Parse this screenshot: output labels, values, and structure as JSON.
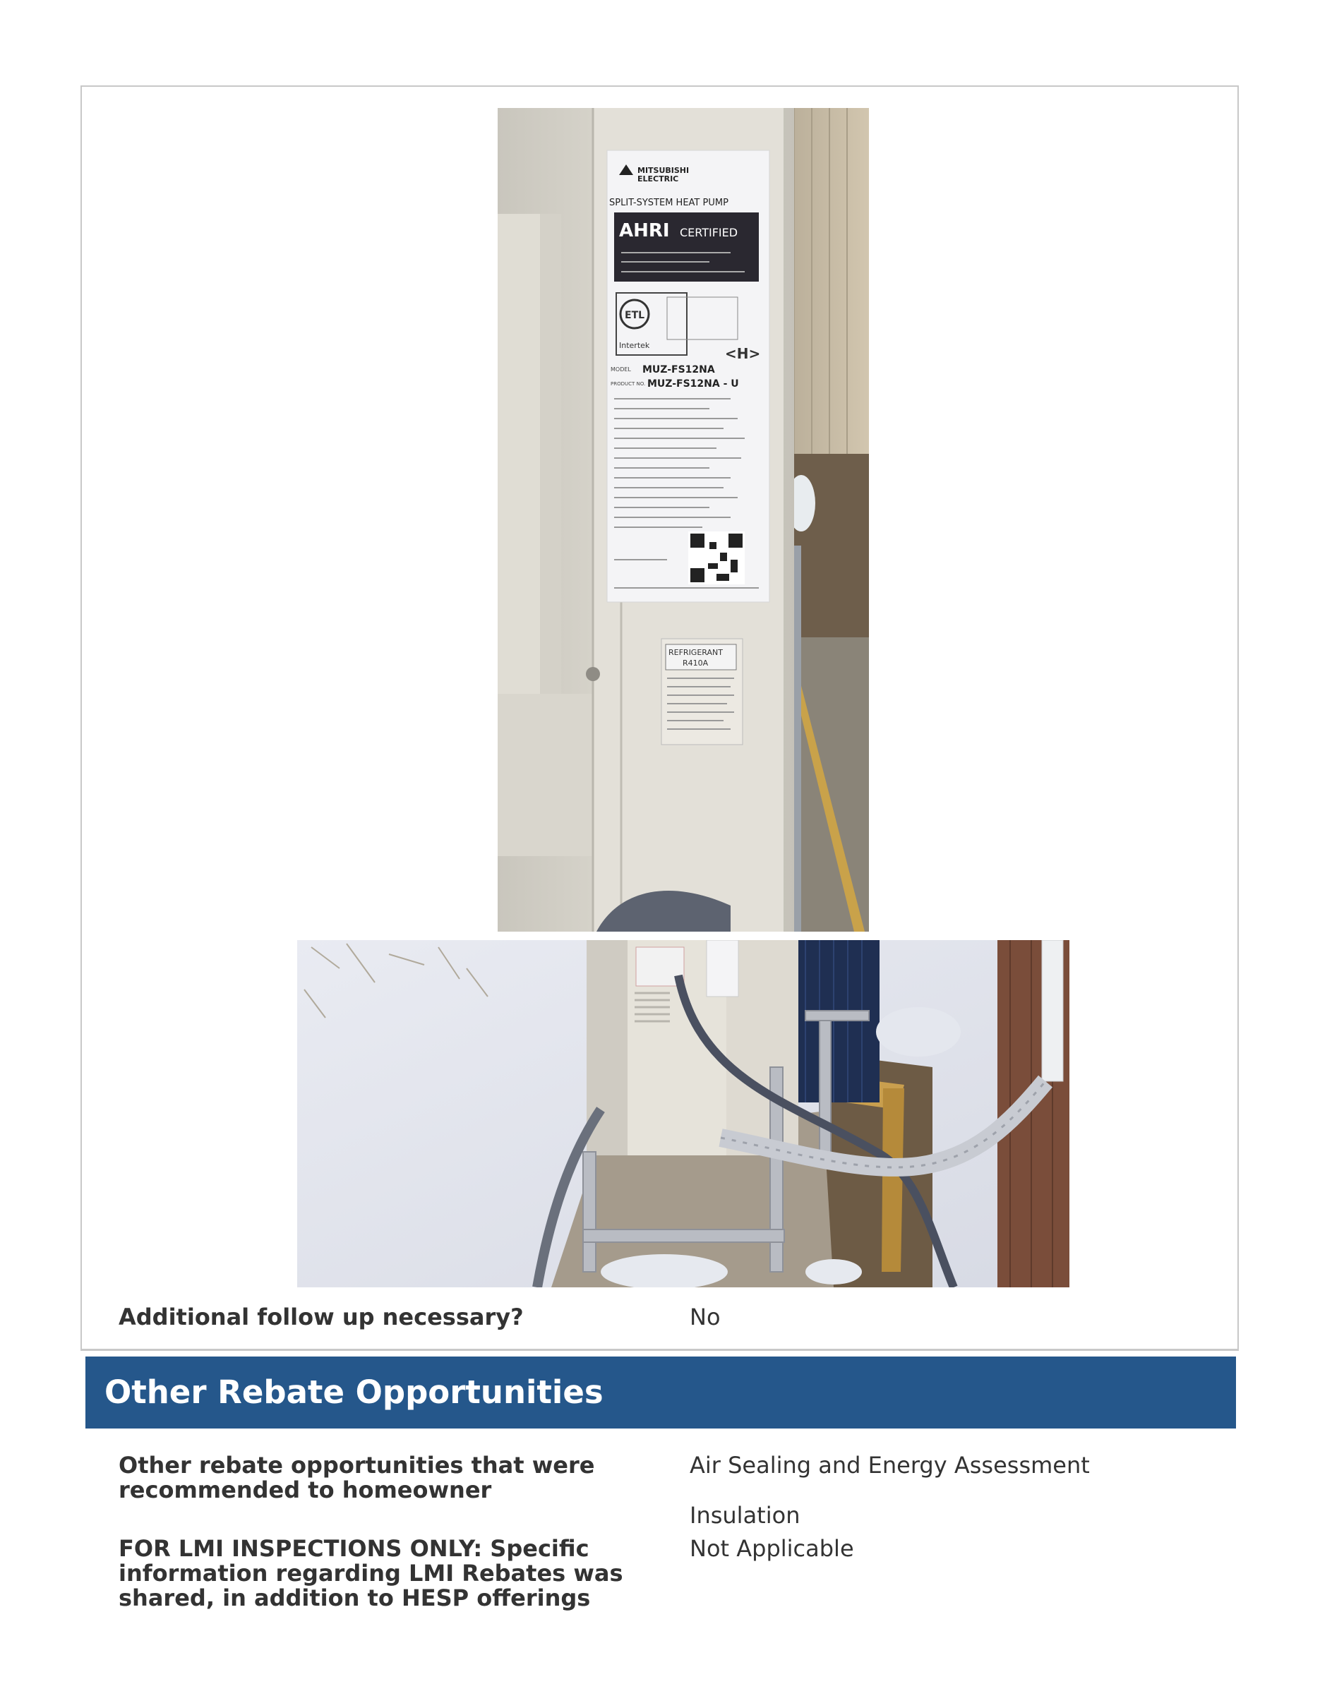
{
  "photos": {
    "label_closeup": {
      "brand": "MITSUBISHI\nELECTRIC",
      "title": "SPLIT-SYSTEM HEAT PUMP",
      "ahri_a": "AHRI",
      "ahri_b": "CERTIFIED",
      "etl": "ETL",
      "intertek": "Intertek",
      "model": "MUZ-FS12NA",
      "serial": "MUZ-FS12NA - U",
      "serial_prefix": "MODEL",
      "serial_prefix2": "PRODUCT NO.",
      "h_mark": "<H>",
      "refrigerant_a": "REFRIGERANT",
      "refrigerant_b": "R410A"
    },
    "outdoor_unit": {}
  },
  "follow_up": {
    "label": "Additional follow up necessary?",
    "value": "No"
  },
  "section": {
    "title": "Other Rebate Opportunities"
  },
  "rebates": {
    "label": "Other rebate opportunities that were recommended to homeowner",
    "value_1": "Air Sealing and Energy Assessment",
    "value_2": "Insulation"
  },
  "lmi": {
    "label": "FOR LMI INSPECTIONS ONLY: Specific information regarding LMI Rebates was shared, in addition to HESP offerings",
    "value": "Not Applicable"
  }
}
